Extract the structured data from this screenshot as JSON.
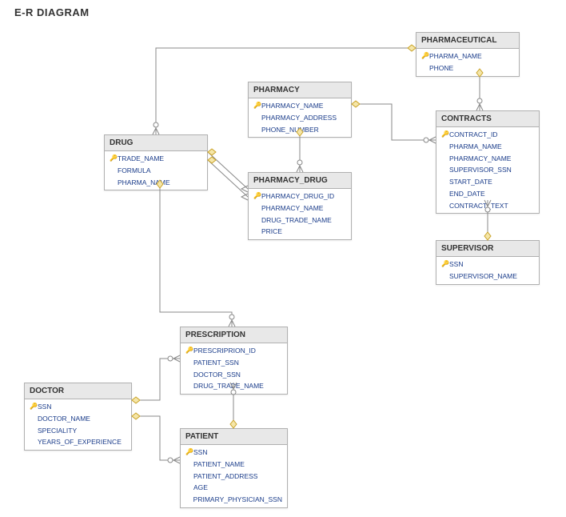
{
  "title": "E-R DIAGRAM",
  "entities": {
    "pharmaceutical": {
      "name": "PHARMACEUTICAL",
      "attributes": [
        {
          "key": true,
          "label": "PHARMA_NAME"
        },
        {
          "key": false,
          "label": "PHONE"
        }
      ]
    },
    "pharmacy": {
      "name": "PHARMACY",
      "attributes": [
        {
          "key": true,
          "label": "PHARMACY_NAME"
        },
        {
          "key": false,
          "label": "PHARMACY_ADDRESS"
        },
        {
          "key": false,
          "label": "PHONE_NUMBER"
        }
      ]
    },
    "contracts": {
      "name": "CONTRACTS",
      "attributes": [
        {
          "key": true,
          "label": "CONTRACT_ID"
        },
        {
          "key": false,
          "label": "PHARMA_NAME"
        },
        {
          "key": false,
          "label": "PHARMACY_NAME"
        },
        {
          "key": false,
          "label": "SUPERVISOR_SSN"
        },
        {
          "key": false,
          "label": "START_DATE"
        },
        {
          "key": false,
          "label": "END_DATE"
        },
        {
          "key": false,
          "label": "CONTRACT_TEXT"
        }
      ]
    },
    "drug": {
      "name": "DRUG",
      "attributes": [
        {
          "key": true,
          "label": "TRADE_NAME"
        },
        {
          "key": false,
          "label": "FORMULA"
        },
        {
          "key": false,
          "label": "PHARMA_NAME"
        }
      ]
    },
    "pharmacy_drug": {
      "name": "PHARMACY_DRUG",
      "attributes": [
        {
          "key": true,
          "label": "PHARMACY_DRUG_ID"
        },
        {
          "key": false,
          "label": "PHARMACY_NAME"
        },
        {
          "key": false,
          "label": "DRUG_TRADE_NAME"
        },
        {
          "key": false,
          "label": "PRICE"
        }
      ]
    },
    "supervisor": {
      "name": "SUPERVISOR",
      "attributes": [
        {
          "key": true,
          "label": "SSN"
        },
        {
          "key": false,
          "label": "SUPERVISOR_NAME"
        }
      ]
    },
    "prescription": {
      "name": "PRESCRIPTION",
      "attributes": [
        {
          "key": true,
          "label": "PRESCRIPRION_ID"
        },
        {
          "key": false,
          "label": "PATIENT_SSN"
        },
        {
          "key": false,
          "label": "DOCTOR_SSN"
        },
        {
          "key": false,
          "label": "DRUG_TRADE_NAME"
        }
      ]
    },
    "doctor": {
      "name": "DOCTOR",
      "attributes": [
        {
          "key": true,
          "label": "SSN"
        },
        {
          "key": false,
          "label": "DOCTOR_NAME"
        },
        {
          "key": false,
          "label": "SPECIALITY"
        },
        {
          "key": false,
          "label": "YEARS_OF_EXPERIENCE"
        }
      ]
    },
    "patient": {
      "name": "PATIENT",
      "attributes": [
        {
          "key": true,
          "label": "SSN"
        },
        {
          "key": false,
          "label": "PATIENT_NAME"
        },
        {
          "key": false,
          "label": "PATIENT_ADDRESS"
        },
        {
          "key": false,
          "label": "AGE"
        },
        {
          "key": false,
          "label": "PRIMARY_PHYSICIAN_SSN"
        }
      ]
    }
  },
  "relationships": [
    {
      "from": "PHARMACEUTICAL",
      "to": "DRUG",
      "type": "one-to-many"
    },
    {
      "from": "PHARMACEUTICAL",
      "to": "CONTRACTS",
      "type": "one-to-many"
    },
    {
      "from": "PHARMACY",
      "to": "CONTRACTS",
      "type": "one-to-many"
    },
    {
      "from": "PHARMACY",
      "to": "PHARMACY_DRUG",
      "type": "one-to-many"
    },
    {
      "from": "DRUG",
      "to": "PHARMACY_DRUG",
      "type": "one-to-many"
    },
    {
      "from": "DRUG",
      "to": "PRESCRIPTION",
      "type": "one-to-many"
    },
    {
      "from": "CONTRACTS",
      "to": "SUPERVISOR",
      "type": "many-to-one"
    },
    {
      "from": "DOCTOR",
      "to": "PRESCRIPTION",
      "type": "one-to-many"
    },
    {
      "from": "PATIENT",
      "to": "PRESCRIPTION",
      "type": "one-to-many"
    },
    {
      "from": "DOCTOR",
      "to": "PATIENT",
      "type": "one-to-many"
    }
  ]
}
